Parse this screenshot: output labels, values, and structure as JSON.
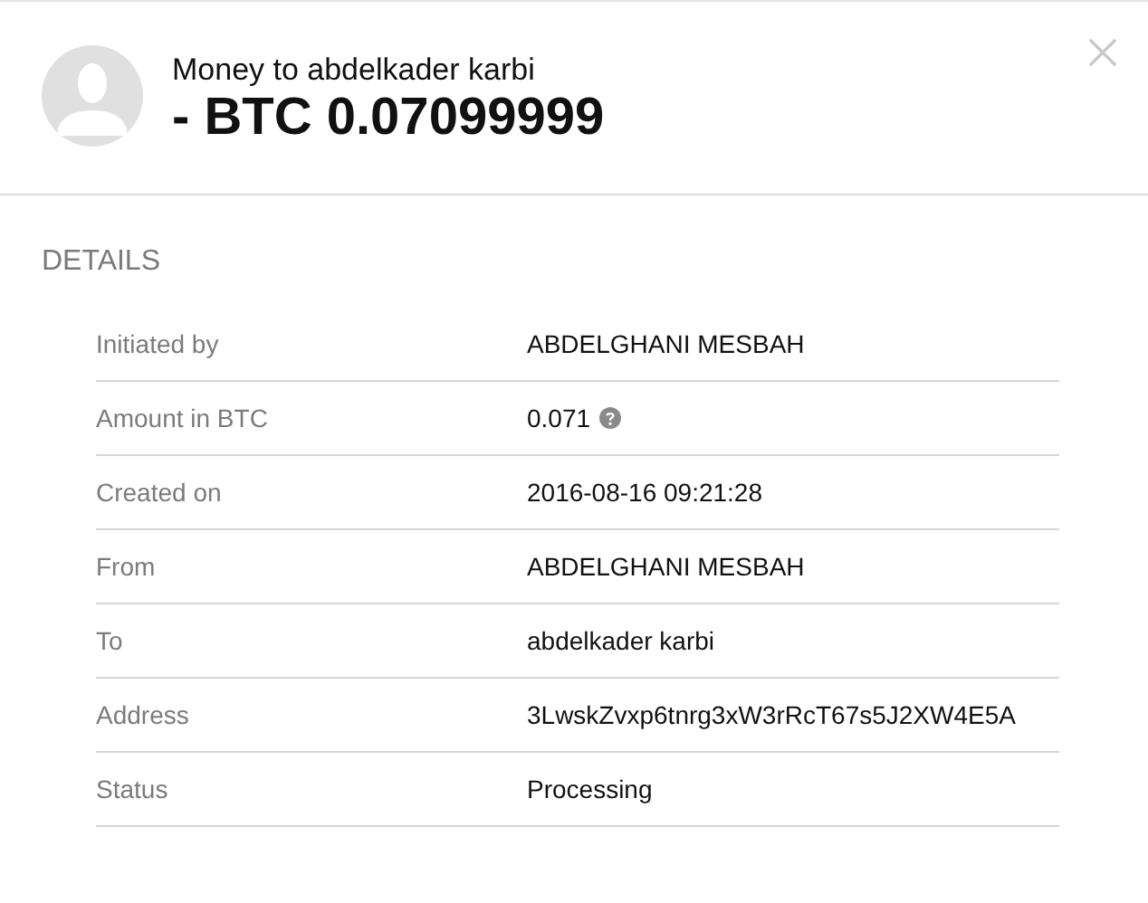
{
  "header": {
    "title": "Money to abdelkader karbi",
    "amount": "- BTC 0.07099999"
  },
  "section_title": "DETAILS",
  "details": [
    {
      "label": "Initiated by",
      "value": "ABDELGHANI MESBAH",
      "help_icon": false
    },
    {
      "label": "Amount in BTC",
      "value": "0.071",
      "help_icon": true
    },
    {
      "label": "Created on",
      "value": "2016-08-16 09:21:28",
      "help_icon": false
    },
    {
      "label": "From",
      "value": "ABDELGHANI MESBAH",
      "help_icon": false
    },
    {
      "label": "To",
      "value": "abdelkader karbi",
      "help_icon": false
    },
    {
      "label": "Address",
      "value": "3LwskZvxp6tnrg3xW3rRcT67s5J2XW4E5A",
      "help_icon": false
    },
    {
      "label": "Status",
      "value": "Processing",
      "help_icon": false
    }
  ]
}
